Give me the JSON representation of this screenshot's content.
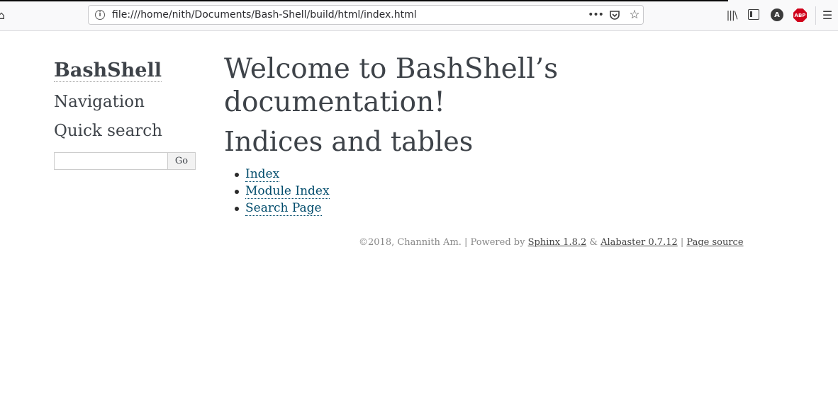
{
  "browser": {
    "url": "file:///home/nith/Documents/Bash-Shell/build/html/index.html",
    "icons": [
      "home-icon",
      "info-icon",
      "more-icon",
      "pocket-icon",
      "star-icon",
      "library-icon",
      "sidebar-toggle-icon",
      "account-icon",
      "abp-icon",
      "menu-icon"
    ],
    "account_label": "A",
    "abp_label": "ABP"
  },
  "sidebar": {
    "logo": "BashShell",
    "navigation_heading": "Navigation",
    "quick_search_heading": "Quick search",
    "search_value": "",
    "go_label": "Go"
  },
  "main": {
    "title": "Welcome to BashShell’s documentation!",
    "indices_heading": "Indices and tables",
    "links": [
      "Index",
      "Module Index",
      "Search Page"
    ]
  },
  "footer": {
    "copyright": "©2018, Channith Am. | Powered by ",
    "sphinx": "Sphinx 1.8.2",
    "amp": " & ",
    "alabaster": "Alabaster 0.7.12",
    "sep": " | ",
    "page_source": "Page source"
  },
  "colors": {
    "text": "#3e4349",
    "link": "#004b6b",
    "footer": "#888888"
  }
}
